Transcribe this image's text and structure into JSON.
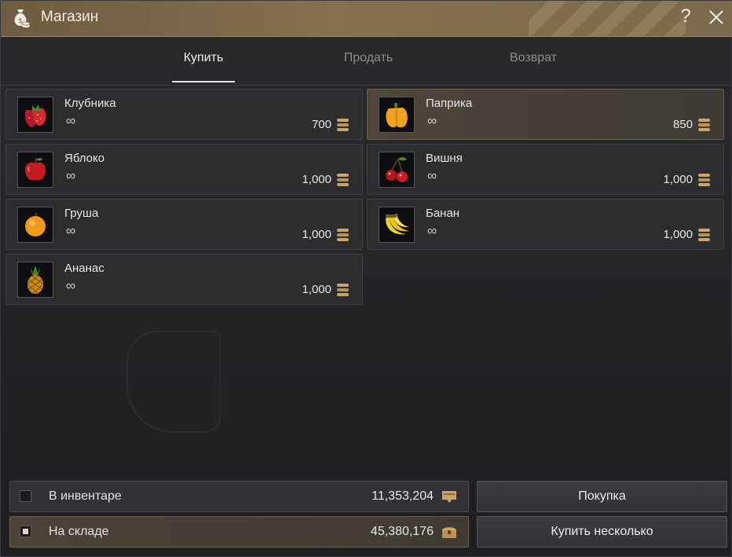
{
  "window": {
    "title": "Магазин",
    "help_label": "?"
  },
  "tabs": [
    {
      "label": "Купить"
    },
    {
      "label": "Продать"
    },
    {
      "label": "Возврат"
    }
  ],
  "items": [
    {
      "name": "Клубника",
      "stock": "∞",
      "price": "700",
      "icon": "strawberry-icon",
      "selected": false
    },
    {
      "name": "Паприка",
      "stock": "∞",
      "price": "850",
      "icon": "paprika-icon",
      "selected": true
    },
    {
      "name": "Яблоко",
      "stock": "∞",
      "price": "1,000",
      "icon": "apple-icon",
      "selected": false
    },
    {
      "name": "Вишня",
      "stock": "∞",
      "price": "1,000",
      "icon": "cherry-icon",
      "selected": false
    },
    {
      "name": "Груша",
      "stock": "∞",
      "price": "1,000",
      "icon": "pear-icon",
      "selected": false
    },
    {
      "name": "Банан",
      "stock": "∞",
      "price": "1,000",
      "icon": "banana-icon",
      "selected": false
    },
    {
      "name": "Ананас",
      "stock": "∞",
      "price": "1,000",
      "icon": "pineapple-icon",
      "selected": false
    }
  ],
  "storage": {
    "inventory": {
      "label": "В инвентаре",
      "amount": "11,353,204",
      "checked": false
    },
    "warehouse": {
      "label": "На складе",
      "amount": "45,380,176",
      "checked": true
    }
  },
  "actions": {
    "buy_label": "Покупка",
    "buy_multiple_label": "Купить несколько"
  },
  "colors": {
    "accent": "#85704f",
    "selected_item": "#4f4639",
    "coin": "#c9a56a"
  }
}
